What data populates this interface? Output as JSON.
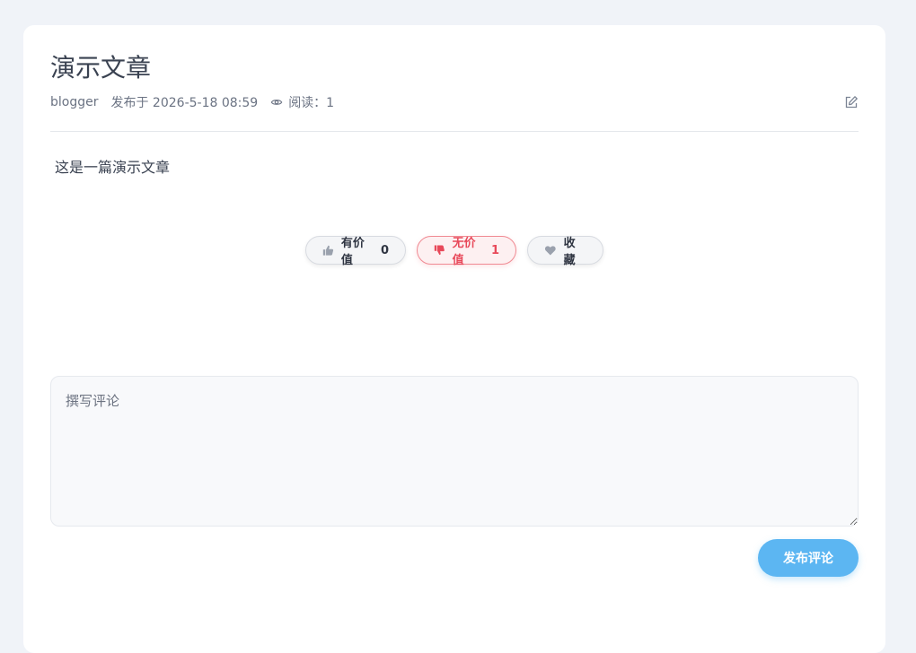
{
  "article": {
    "title": "演示文章",
    "author": "blogger",
    "published": "发布于 2026-5-18 08:59",
    "views": "阅读：1",
    "body": "这是一篇演示文章"
  },
  "reactions": {
    "like": {
      "label": "有价值",
      "count": "0",
      "icon": "thumbs-up-icon"
    },
    "dislike": {
      "label": "无价值",
      "count": "1",
      "icon": "thumbs-down-icon",
      "color": "#e8495a"
    },
    "favorite": {
      "label": "收藏",
      "icon": "heart-icon"
    }
  },
  "comment": {
    "placeholder": "撰写评论",
    "submit_label": "发布评论",
    "accent": "#5cb6f2"
  }
}
